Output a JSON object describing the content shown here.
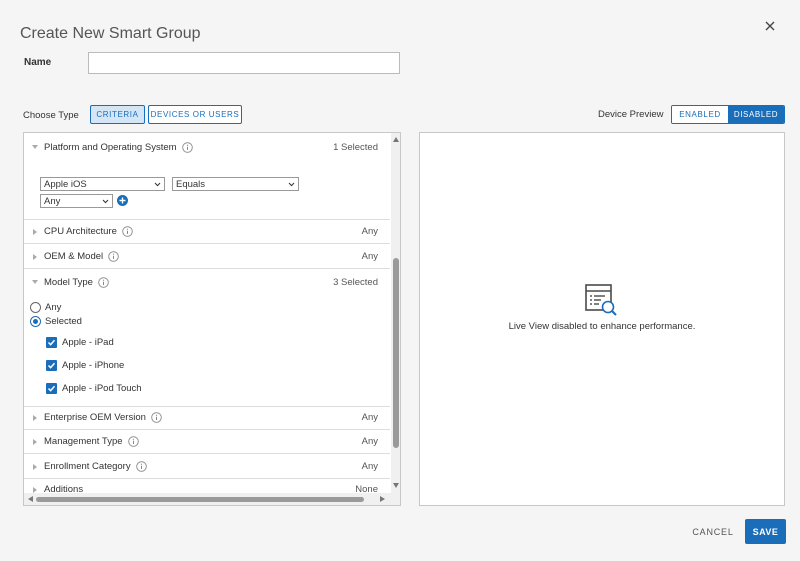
{
  "dialog": {
    "title": "Create New Smart Group",
    "name_label": "Name",
    "name_value": "",
    "choose_type_label": "Choose Type",
    "type_buttons": {
      "criteria": "CRITERIA",
      "devices": "DEVICES OR USERS"
    },
    "device_preview_label": "Device Preview",
    "preview_toggle": {
      "enabled": "ENABLED",
      "disabled": "DISABLED"
    }
  },
  "criteria": {
    "platform": {
      "label": "Platform and Operating System",
      "value": "1 Selected",
      "os_select": "Apple iOS",
      "operator_select": "Equals",
      "version_select": "Any"
    },
    "cpu": {
      "label": "CPU Architecture",
      "value": "Any"
    },
    "oem": {
      "label": "OEM & Model",
      "value": "Any"
    },
    "model_type": {
      "label": "Model Type",
      "value": "3 Selected",
      "radio_any": "Any",
      "radio_selected": "Selected",
      "options": [
        "Apple - iPad",
        "Apple - iPhone",
        "Apple - iPod Touch"
      ]
    },
    "enterprise_oem": {
      "label": "Enterprise OEM Version",
      "value": "Any"
    },
    "management_type": {
      "label": "Management Type",
      "value": "Any"
    },
    "enrollment_category": {
      "label": "Enrollment Category",
      "value": "Any"
    },
    "additions": {
      "label": "Additions",
      "value": "None"
    }
  },
  "preview": {
    "message": "Live View disabled to enhance performance."
  },
  "footer": {
    "cancel": "CANCEL",
    "save": "SAVE"
  },
  "colors": {
    "accent": "#1a6db8",
    "selected_bg": "#d4e6f5"
  }
}
